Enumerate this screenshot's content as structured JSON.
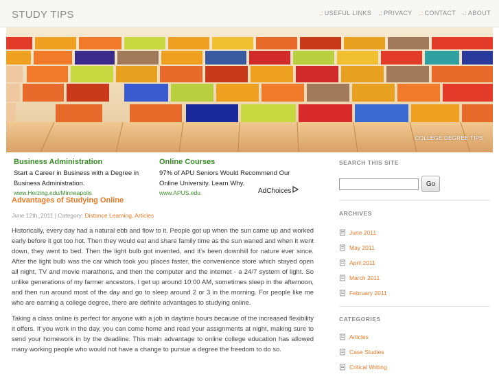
{
  "site": {
    "title": "STUDY TIPS"
  },
  "nav": [
    {
      "prefix": ".:",
      "label": "USEFUL LINKS"
    },
    {
      "prefix": ".:",
      "label": "PRIVACY"
    },
    {
      "prefix": ".:",
      "label": "CONTACT"
    },
    {
      "prefix": ".:",
      "label": "ABOUT"
    }
  ],
  "banner": {
    "caption": "COLLEGE DEGREE TIPS"
  },
  "ads": [
    {
      "title": "Business Administration",
      "text": "Start a Career in Business with a Degree in Business Administration.",
      "url": "www.Herzing.edu/Minneapolis"
    },
    {
      "title": "Online Courses",
      "text": "97% of APU Seniors Would Recommend Our Online University. Learn Why.",
      "url": "www.APUS.edu"
    }
  ],
  "adchoices": {
    "label": "AdChoices",
    "icon": "adchoices-triangle"
  },
  "post": {
    "title": "Advantages of Studying Online",
    "date": "June 12th, 2011",
    "category_prefix": "| Category:",
    "categories": "Distance Learning, Articles",
    "paragraphs": [
      "Historically, every day had a natural ebb and flow to it. People got up when the sun came up and worked early before it got too hot. Then they would eat and share family time as the sun waned and when it went down, they went to bed.  Then the light bulb got invented, and it's been downhill for nature ever since.  After the light bulb was the car which took you places faster, the convenience store which stayed open all night, TV and movie marathons, and then the computer and the internet - a 24/7 system of light.  So unlike generations of my farmer ancestors, I get up around 10:00 AM, sometimes sleep in the afternoon, and then run around most of the day and go to sleep around 2 or 3 in the morning.  For people like me who are earning a college degree, there are definite advantages to studying online.",
      "Taking a class online is perfect for anyone with a job in daytime hours because of the increased flexibility it offers. If you work in the day, you can come home and read your assignments at night, making sure to send your homework in by the deadline.  This main advantage to online college education has allowed many working people who would not have a change to pursue a degree the freedom to do so."
    ]
  },
  "sidebar": {
    "search": {
      "heading": "SEARCH THIS SITE",
      "value": "",
      "placeholder": "",
      "button": "Go"
    },
    "archives": {
      "heading": "ARCHIVES",
      "items": [
        "June 2011",
        "May 2011",
        "April 2011",
        "March 2011",
        "February 2011"
      ]
    },
    "categories": {
      "heading": "CATEGORIES",
      "items": [
        "Articles",
        "Case Studies",
        "Critical Writing"
      ]
    }
  },
  "colors": {
    "accent": "#e07a2a",
    "ad_green": "#3a8a2a",
    "muted": "#8a8a8a"
  }
}
